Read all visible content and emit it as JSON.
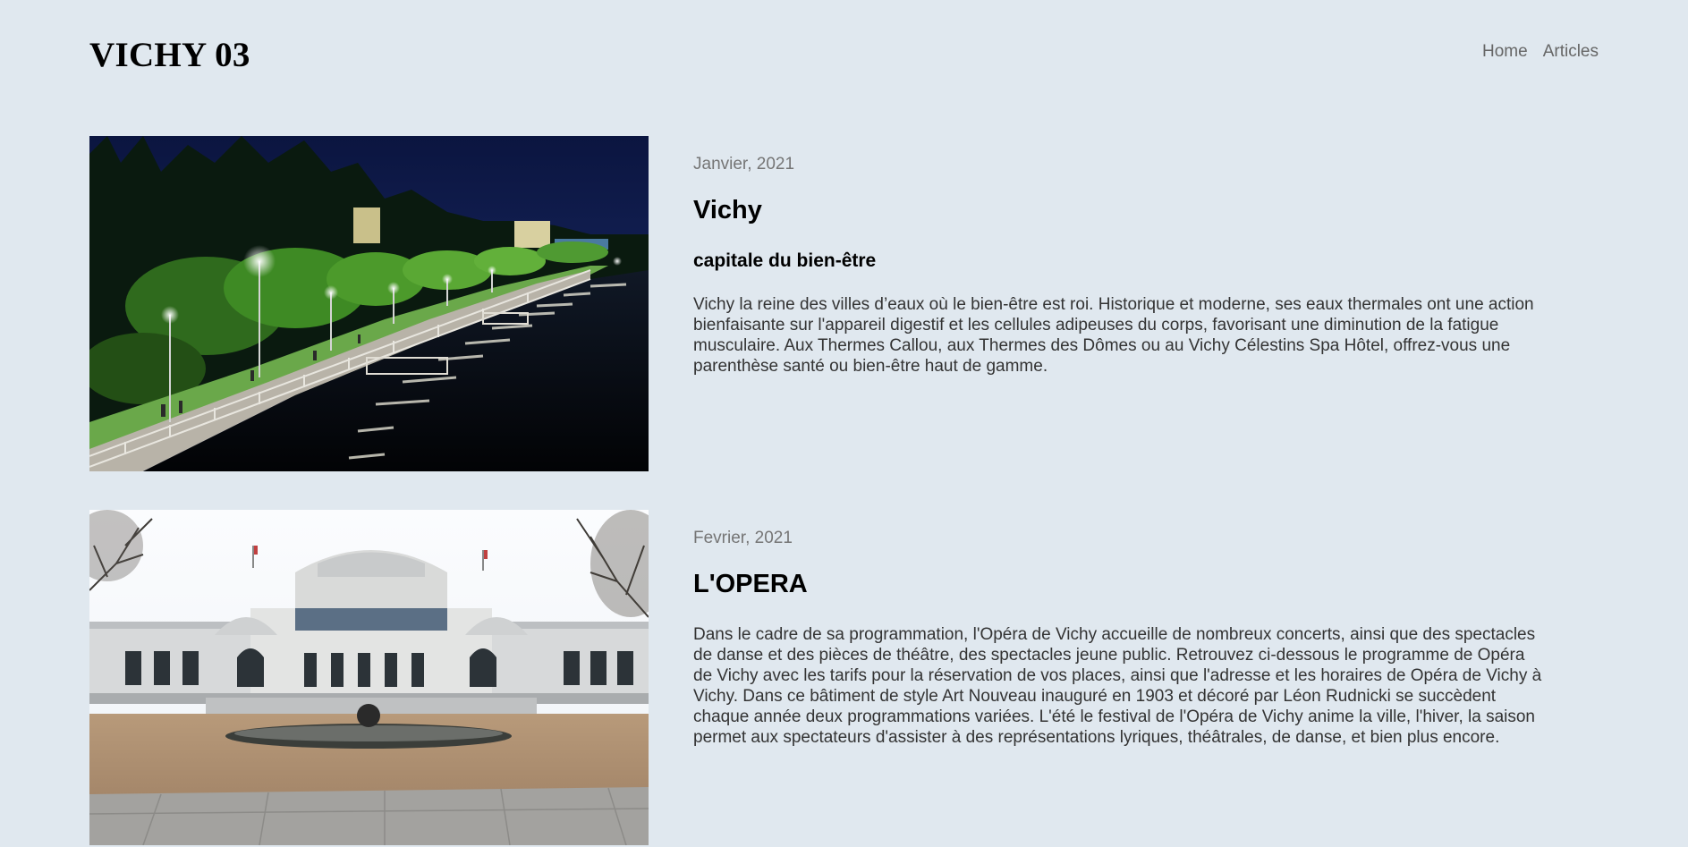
{
  "header": {
    "site_title": "VICHY 03",
    "nav": [
      {
        "label": "Home"
      },
      {
        "label": "Articles"
      }
    ]
  },
  "articles": [
    {
      "date": "Janvier, 2021",
      "title": "Vichy",
      "subtitle": "capitale du bien-être",
      "text": "Vichy la reine des villes d’eaux où le bien-être est roi. Historique et moderne, ses eaux thermales ont une action bienfaisante sur l'appareil digestif et les cellules adipeuses du corps, favorisant une diminution de la fatigue musculaire. Aux Thermes Callou, aux Thermes des Dômes ou au Vichy Célestins Spa Hôtel, offrez-vous une parenthèse santé ou bien-être haut de gamme.",
      "image": "riverside-promenade-night-photo"
    },
    {
      "date": "Fevrier, 2021",
      "title": "L'OPERA",
      "text": "Dans le cadre de sa programmation, l'Opéra de Vichy accueille de nombreux concerts, ainsi que des spectacles de danse et des pièces de théâtre, des spectacles jeune public. Retrouvez ci-dessous le programme de Opéra de Vichy avec les tarifs pour la réservation de vos places, ainsi que l'adresse et les horaires de Opéra de Vichy à Vichy. Dans ce bâtiment de style Art Nouveau inauguré en 1903 et décoré par Léon Rudnicki se succèdent chaque année deux programmations variées. L'été le festival de l'Opéra de Vichy anime la ville, l'hiver, la saison permet aux spectateurs d'assister à des représentations lyriques, théâtrales, de danse, et bien plus encore.",
      "image": "opera-building-photo"
    }
  ],
  "colors": {
    "background": "#e0e8ef",
    "nav_text": "#666666",
    "date_text": "#757575",
    "body_text": "#333333",
    "heading_text": "#000000"
  }
}
